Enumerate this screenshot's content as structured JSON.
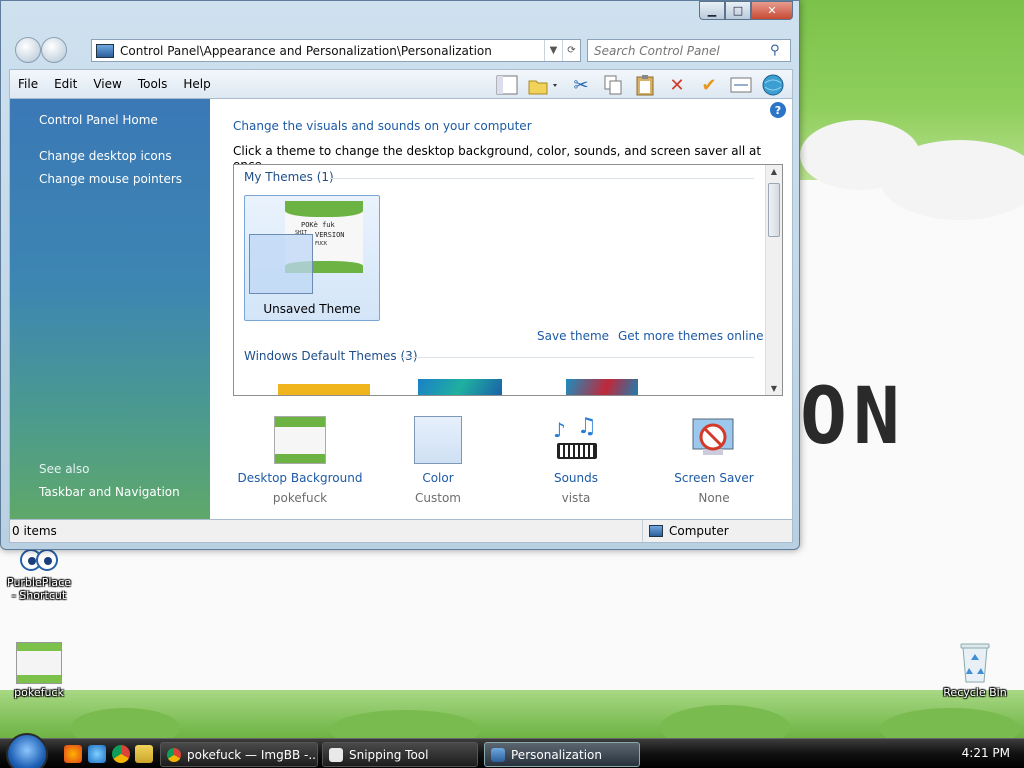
{
  "window": {
    "address_path": "Control Panel\\Appearance and Personalization\\Personalization",
    "search_placeholder": "Search Control Panel",
    "caption": {
      "minimize": "▁",
      "maximize": "□",
      "close": "✕"
    }
  },
  "menu": [
    "File",
    "Edit",
    "View",
    "Tools",
    "Help"
  ],
  "toolbar_icons": [
    "layout-icon",
    "folder-options-icon",
    "cut-icon",
    "copy-icon",
    "paste-icon",
    "delete-icon",
    "check-icon",
    "properties-icon",
    "globe-icon"
  ],
  "sidebar": {
    "home": "Control Panel Home",
    "links": [
      "Change desktop icons",
      "Change mouse pointers"
    ],
    "see_also_title": "See also",
    "see_also_links": [
      "Taskbar and Navigation"
    ]
  },
  "main": {
    "heading": "Change the visuals and sounds on your computer",
    "subtext": "Click a theme to change the desktop background, color, sounds, and screen saver all at once.",
    "my_themes_title": "My Themes (1)",
    "unsaved_theme_label": "Unsaved Theme",
    "save_theme": "Save theme",
    "get_more_themes": "Get more themes online",
    "default_themes_title": "Windows Default Themes (3)",
    "thumb_text": {
      "line1": "POKè fuk",
      "line2": "VERSION",
      "line3": "SHIT",
      "line4": "FUCK"
    }
  },
  "settings": [
    {
      "title": "Desktop Background",
      "value": "pokefuck"
    },
    {
      "title": "Color",
      "value": "Custom"
    },
    {
      "title": "Sounds",
      "value": "vista"
    },
    {
      "title": "Screen Saver",
      "value": "None"
    }
  ],
  "status": {
    "items": "0 items",
    "zone": "Computer"
  },
  "desktop": {
    "icons": [
      {
        "label": "PurblePlace - Shortcut"
      },
      {
        "label": "pokefuck"
      },
      {
        "label": "Recycle Bin"
      }
    ],
    "wallpaper_text": "ON"
  },
  "taskbar": {
    "buttons": [
      "pokefuck — ImgBB -...",
      "Snipping Tool",
      "Personalization"
    ],
    "clock": "4:21 PM"
  },
  "colors": {
    "link_blue": "#1d5aa6",
    "sidebar_top": "#3a78b6",
    "sidebar_bottom": "#5fa86a",
    "wallpaper_green": "#7cc24a"
  }
}
